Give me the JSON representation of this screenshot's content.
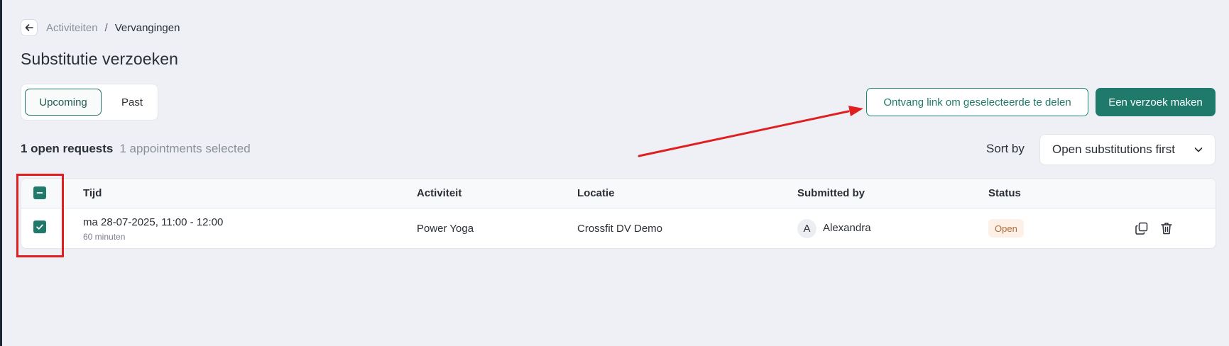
{
  "breadcrumb": {
    "back_icon": "arrow-left-icon",
    "parent": "Activiteiten",
    "separator": "/",
    "current": "Vervangingen"
  },
  "page_title": "Substitutie verzoeken",
  "tabs": [
    {
      "label": "Upcoming",
      "active": true
    },
    {
      "label": "Past",
      "active": false
    }
  ],
  "actions": {
    "share_link": "Ontvang link om geselecteerde te delen",
    "create_request": "Een verzoek maken"
  },
  "summary": {
    "open_requests": "1 open requests",
    "selected": "1 appointments selected"
  },
  "sort": {
    "label": "Sort by",
    "value": "Open substitutions first"
  },
  "table": {
    "columns": [
      "Tijd",
      "Activiteit",
      "Locatie",
      "Submitted by",
      "Status"
    ],
    "header_checkbox": "indeterminate",
    "rows": [
      {
        "checked": true,
        "time": "ma 28-07-2025, 11:00 - 12:00",
        "duration": "60 minuten",
        "activity": "Power Yoga",
        "location": "Crossfit DV Demo",
        "avatar_initial": "A",
        "submitted_by": "Alexandra",
        "status": "Open"
      }
    ]
  },
  "icons": {
    "copy": "copy-icon",
    "delete": "trash-icon",
    "chevron": "chevron-down-icon"
  },
  "colors": {
    "accent": "#1f7a6b",
    "annotation": "#e02020",
    "status_open_bg": "#fdf0e7",
    "status_open_text": "#b06a37"
  }
}
